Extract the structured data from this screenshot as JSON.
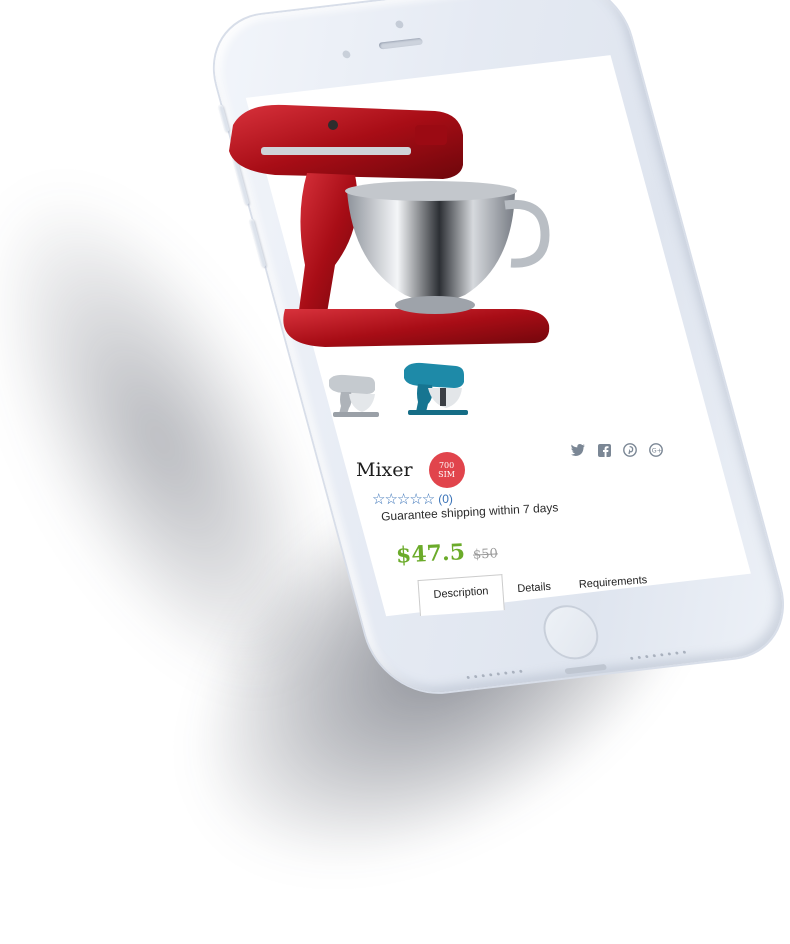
{
  "product": {
    "name": "Mixer",
    "badge_line1": "700",
    "badge_line2": "SIM",
    "rating_count": "(0)",
    "stars": "☆☆☆☆☆",
    "shipping_note": "Guarantee shipping within 7 days",
    "price": "$47.5",
    "old_price": "$50"
  },
  "tabs": [
    {
      "label": "Description"
    },
    {
      "label": "Details"
    },
    {
      "label": "Requirements"
    }
  ],
  "social_icons": [
    "twitter-icon",
    "facebook-icon",
    "pinterest-icon",
    "google-plus-icon"
  ],
  "colors": {
    "price": "#6bab2a",
    "badge": "#e1444c",
    "rating": "#3a73b8",
    "mixer_main": "#b4121c",
    "mixer_alt": "#1e8aa8",
    "phone_body": "#e5eaf3"
  }
}
